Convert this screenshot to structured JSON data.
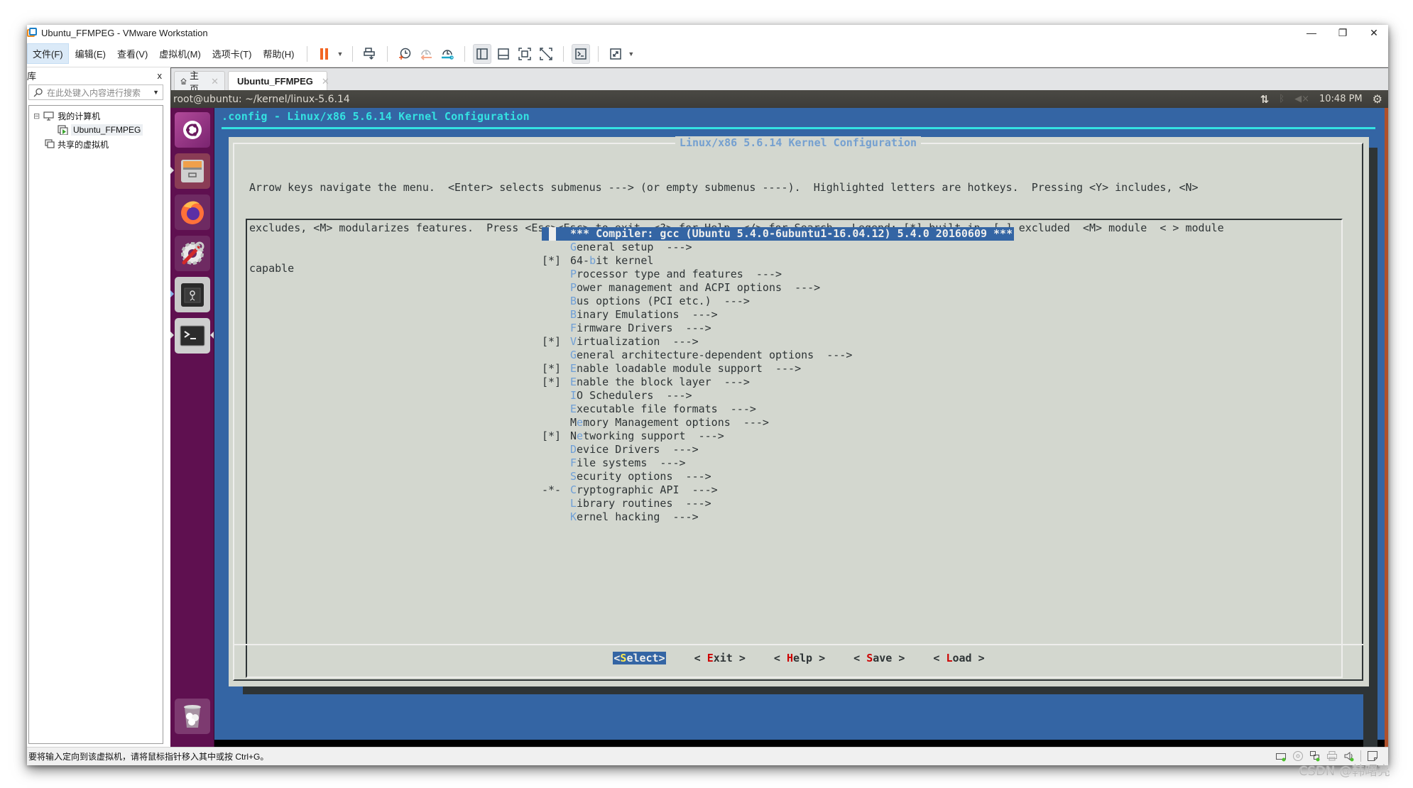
{
  "window": {
    "title": "Ubuntu_FFMPEG - VMware Workstation",
    "controls": {
      "minimize": "—",
      "restore": "❐",
      "close": "✕"
    }
  },
  "menubar": {
    "items": [
      "文件(F)",
      "编辑(E)",
      "查看(V)",
      "虚拟机(M)",
      "选项卡(T)",
      "帮助(H)"
    ]
  },
  "toolbar": {
    "icons": [
      "pause-icon",
      "send-ctrl-alt-del-icon",
      "snapshot-take-icon",
      "snapshot-revert-icon",
      "snapshot-manager-icon",
      "show-library-icon",
      "show-thumbnail-bar-icon",
      "full-screen-icon",
      "unity-icon",
      "console-view-icon",
      "stretch-guest-icon"
    ]
  },
  "library": {
    "title": "库",
    "close": "x",
    "search_placeholder": "在此处键入内容进行搜索",
    "tree": [
      {
        "label": "我的计算机",
        "expander": "⊟"
      },
      {
        "label": "Ubuntu_FFMPEG",
        "selected": true
      },
      {
        "label": "共享的虚拟机"
      }
    ]
  },
  "tabs": [
    {
      "label": "主页",
      "icon": "home-icon"
    },
    {
      "label": "Ubuntu_FFMPEG",
      "icon": "vm-running-icon",
      "active": true
    }
  ],
  "guest": {
    "topbar_title": "root@ubuntu: ~/kernel/linux-5.6.14",
    "clock": "10:48 PM",
    "launcher": [
      "ubuntu-dash-icon",
      "files-icon",
      "firefox-icon",
      "system-settings-icon",
      "vmware-tools-icon",
      "terminal-icon",
      "trash-icon"
    ]
  },
  "menuconfig": {
    "header": ".config - Linux/x86 5.6.14 Kernel Configuration",
    "dialog_title": "Linux/x86 5.6.14 Kernel Configuration",
    "help_lines": [
      "Arrow keys navigate the menu.  <Enter> selects submenus ---> (or empty submenus ----).  Highlighted letters are hotkeys.  Pressing <Y> includes, <N>",
      "excludes, <M> modularizes features.  Press <Esc><Esc> to exit, <?> for Help, </> for Search.  Legend: [*] built-in  [ ] excluded  <M> module  < > module",
      "capable"
    ],
    "items": [
      {
        "mark": "",
        "pre": "",
        "hk": "",
        "post": "*** Compiler: gcc (Ubuntu 5.4.0-6ubuntu1-16.04.12) 5.4.0 20160609 ***",
        "selected": true
      },
      {
        "mark": "",
        "pre": "",
        "hk": "G",
        "post": "eneral setup  --->"
      },
      {
        "mark": "[*]",
        "pre": "64-",
        "hk": "b",
        "post": "it kernel"
      },
      {
        "mark": "",
        "pre": "",
        "hk": "P",
        "post": "rocessor type and features  --->"
      },
      {
        "mark": "",
        "pre": "",
        "hk": "P",
        "post": "ower management and ACPI options  --->"
      },
      {
        "mark": "",
        "pre": "",
        "hk": "B",
        "post": "us options (PCI etc.)  --->"
      },
      {
        "mark": "",
        "pre": "",
        "hk": "B",
        "post": "inary Emulations  --->"
      },
      {
        "mark": "",
        "pre": "",
        "hk": "F",
        "post": "irmware Drivers  --->"
      },
      {
        "mark": "[*]",
        "pre": "",
        "hk": "V",
        "post": "irtualization  --->"
      },
      {
        "mark": "",
        "pre": "",
        "hk": "G",
        "post": "eneral architecture-dependent options  --->"
      },
      {
        "mark": "[*]",
        "pre": "",
        "hk": "E",
        "post": "nable loadable module support  --->"
      },
      {
        "mark": "[*]",
        "pre": "",
        "hk": "E",
        "post": "nable the block layer  --->"
      },
      {
        "mark": "",
        "pre": "",
        "hk": "I",
        "post": "O Schedulers  --->"
      },
      {
        "mark": "",
        "pre": "",
        "hk": "E",
        "post": "xecutable file formats  --->"
      },
      {
        "mark": "",
        "pre": "M",
        "hk": "e",
        "post": "mory Management options  --->"
      },
      {
        "mark": "[*]",
        "pre": "N",
        "hk": "e",
        "post": "tworking support  --->"
      },
      {
        "mark": "",
        "pre": "",
        "hk": "D",
        "post": "evice Drivers  --->"
      },
      {
        "mark": "",
        "pre": "",
        "hk": "F",
        "post": "ile systems  --->"
      },
      {
        "mark": "",
        "pre": "",
        "hk": "S",
        "post": "ecurity options  --->"
      },
      {
        "mark": "-*-",
        "pre": "",
        "hk": "C",
        "post": "ryptographic API  --->"
      },
      {
        "mark": "",
        "pre": "",
        "hk": "L",
        "post": "ibrary routines  --->"
      },
      {
        "mark": "",
        "pre": "",
        "hk": "K",
        "post": "ernel hacking  --->"
      }
    ],
    "buttons": [
      {
        "open": "<",
        "hk": "S",
        "rest": "elect",
        "close": ">",
        "selected": true
      },
      {
        "open": "< ",
        "hk": "E",
        "rest": "xit",
        "close": " >"
      },
      {
        "open": "< ",
        "hk": "H",
        "rest": "elp",
        "close": " >"
      },
      {
        "open": "< ",
        "hk": "S",
        "rest": "ave",
        "close": " >"
      },
      {
        "open": "< ",
        "hk": "L",
        "rest": "oad",
        "close": " >"
      }
    ],
    "colors": {
      "background": "#3465a4",
      "dialog": "#d3d7cf",
      "hotkey": "#6f9fd6",
      "button_hotkey": "#cc0000",
      "header": "#34e2e2"
    }
  },
  "statusbar": {
    "message": "要将输入定向到该虚拟机，请将鼠标指针移入其中或按 Ctrl+G。",
    "icons": [
      "hard-disk-icon",
      "cd-rom-icon",
      "network-icon",
      "printer-icon",
      "sound-icon",
      "message-log-icon"
    ]
  },
  "watermark": "CSDN @韩曙亮"
}
